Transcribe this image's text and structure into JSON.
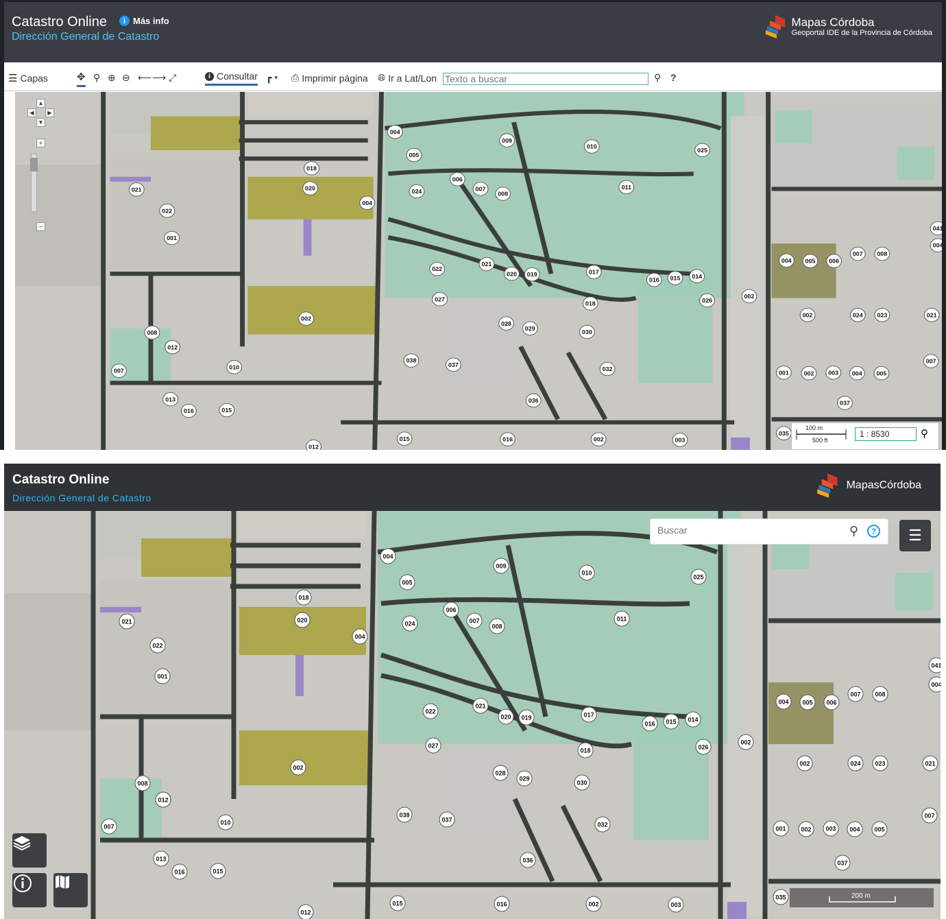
{
  "top": {
    "header": {
      "title": "Catastro Online",
      "info_label": "Más info",
      "subtitle": "Dirección General de Catastro",
      "brand_name": "Mapas Córdoba",
      "brand_tagline": "Geoportal IDE de la Provincia de Córdoba"
    },
    "toolbar": {
      "layers_label": "Capas",
      "query_label": "Consultar",
      "print_label": "Imprimir página",
      "goto_label": "Ir a Lat/Lon",
      "search_placeholder": "Texto a buscar",
      "help_label": "?"
    },
    "scale": {
      "meters": "100 m",
      "feet": "500 ft",
      "ratio": "1 : 8530"
    }
  },
  "bottom": {
    "header": {
      "title": "Catastro Online",
      "subtitle": "Dirección General de Catastro",
      "brand_name": "MapasCórdoba"
    },
    "search": {
      "placeholder": "Buscar"
    },
    "scale": {
      "label": "200 m"
    }
  },
  "map_labels": [
    "004",
    "005",
    "009",
    "010",
    "025",
    "006",
    "007",
    "008",
    "011",
    "024",
    "018",
    "020",
    "004",
    "021",
    "022",
    "001",
    "004",
    "022",
    "021",
    "020",
    "019",
    "017",
    "016",
    "015",
    "014",
    "002",
    "041",
    "004",
    "005",
    "006",
    "007",
    "008",
    "012",
    "027",
    "018",
    "026",
    "002",
    "028",
    "029",
    "030",
    "002",
    "024",
    "023",
    "021",
    "008",
    "012",
    "010",
    "007",
    "038",
    "037",
    "032",
    "001",
    "002",
    "003",
    "004",
    "005",
    "007",
    "013",
    "016",
    "015",
    "036",
    "037",
    "035",
    "015",
    "016",
    "002",
    "003",
    "012"
  ],
  "colors": {
    "map_base": "#c9c8c2",
    "parcel_green": "#9fcdb7",
    "parcel_olive": "#a8a13a",
    "parcel_purple": "#9b86c9",
    "road": "#3b3f3c",
    "accent_blue": "#2196f3",
    "accent_cyan": "#29b6f6"
  },
  "icons": {
    "menu": "hamburger-icon",
    "pan": "move-icon",
    "search": "magnifier-icon",
    "zoom_in": "zoom-in-icon",
    "zoom_out": "zoom-out-icon",
    "back": "arrow-left-icon",
    "forward": "arrow-right-icon",
    "fullscreen": "expand-icon",
    "info": "info-icon",
    "ruler": "ruler-icon",
    "print": "printer-icon",
    "globe": "globe-icon",
    "layers": "layers-icon",
    "basemap": "map-icon"
  }
}
